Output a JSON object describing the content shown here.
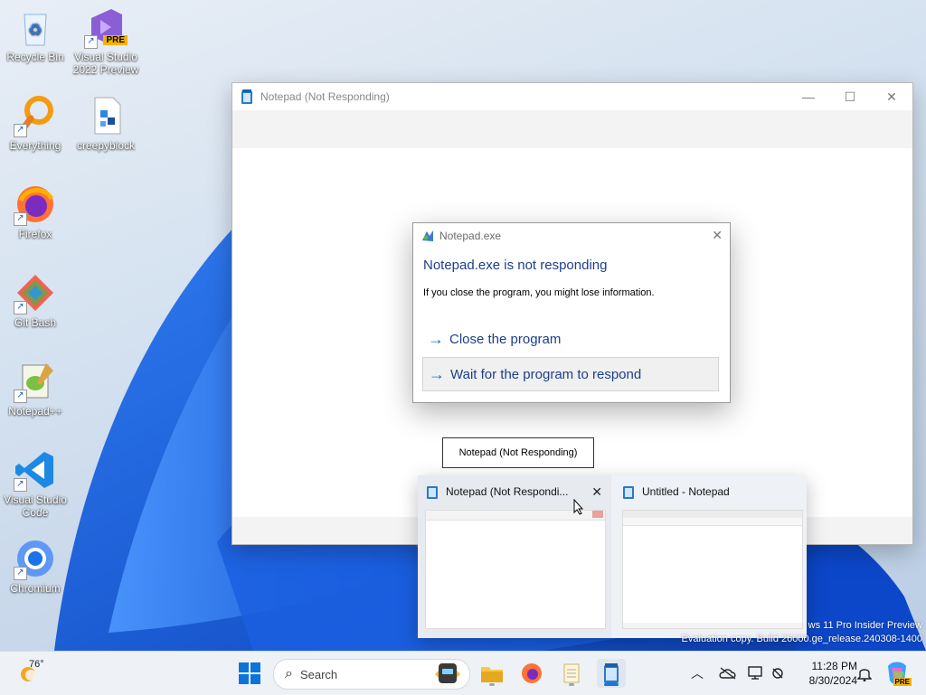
{
  "desktop": {
    "icons": [
      {
        "label": "Recycle Bin"
      },
      {
        "label": "Visual Studio 2022 Preview",
        "badge": "PRE"
      },
      {
        "label": "Everything"
      },
      {
        "label": "creepyblock"
      },
      {
        "label": "Firefox"
      },
      {
        "label": "Git Bash"
      },
      {
        "label": "Notepad++"
      },
      {
        "label": "Visual Studio Code"
      },
      {
        "label": "Chromium"
      }
    ]
  },
  "notepad_window": {
    "title": "Notepad (Not Responding)",
    "controls": {
      "minimize": "—",
      "maximize": "☐",
      "close": "✕"
    }
  },
  "dialog": {
    "title": "Notepad.exe",
    "heading": "Notepad.exe is not responding",
    "message": "If you close the program, you might lose information.",
    "option_close": "Close the program",
    "option_wait": "Wait for the program to respond"
  },
  "tooltip": {
    "text": "Notepad (Not Responding)"
  },
  "thumbnails": [
    {
      "title": "Notepad (Not Respondi..."
    },
    {
      "title": "Untitled - Notepad"
    }
  ],
  "watermark": {
    "line1": "ws 11 Pro Insider Preview",
    "line2": "Evaluation copy. Build 26000.ge_release.240308-1400"
  },
  "taskbar": {
    "weather_temp": "76°",
    "search_label": "Search",
    "time": "11:28 PM",
    "date": "8/30/2024",
    "copilot_badge": "PRE"
  },
  "colors": {
    "accent": "#1a73e8",
    "dialog_heading": "#1c3f8c",
    "dialog_arrow": "#1a6fd0"
  }
}
